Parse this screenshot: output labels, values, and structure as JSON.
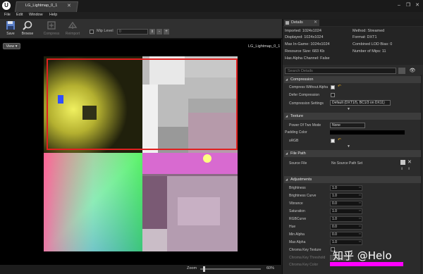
{
  "window": {
    "tab_title": "LG_Lightmap_0_1",
    "logo": "U",
    "close": "✕",
    "controls": [
      "–",
      "❐",
      "✕"
    ]
  },
  "menu": [
    "File",
    "Edit",
    "Window",
    "Help"
  ],
  "toolbar": {
    "save_label": "Save",
    "browse_label": "Browse",
    "compress_label": "Compress",
    "reimport_label": "Reimport",
    "mip_level_label": "Mip Level",
    "mip_level_value": "0",
    "spin_icon": "⇕",
    "minus_label": "-",
    "plus_label": "+"
  },
  "viewport": {
    "view_button": "View ▾",
    "texture_label": "LG_Lightmap_0_1",
    "zoom_label": "Zoom",
    "zoom_value": "60%",
    "zoom_level": 0.05
  },
  "details": {
    "tab_label": "Details",
    "close": "✕",
    "eye_icon": "👁",
    "info_left": [
      "Imported: 1024x1024",
      "Displayed: 1024x1024",
      "Max In-Game: 1024x1024",
      "Resource Size: 683 Kb",
      "Has Alpha Channel: False"
    ],
    "info_right": [
      "Method: Streamed",
      "Format: DXT1",
      "Combined LOD Bias: 0",
      "Number of Mips: 11"
    ],
    "search_placeholder": "Search Details",
    "compression": {
      "title": "Compression",
      "compress_without_alpha": "Compress Without Alpha",
      "defer_compression": "Defer Compression",
      "compression_settings": "Compression Settings",
      "compression_settings_value": "Default (DXT1/5, BC1/3 on DX11)"
    },
    "texture": {
      "title": "Texture",
      "power_of_two": "Power Of Two Mode",
      "power_of_two_value": "None",
      "padding_color": "Padding Color",
      "srgb": "sRGB"
    },
    "file_path": {
      "title": "File Path",
      "source_file": "Source File",
      "source_file_value": "No Source Path Set"
    },
    "adjustments": {
      "title": "Adjustments",
      "rows": [
        {
          "label": "Brightness",
          "value": "1.0"
        },
        {
          "label": "Brightness Curve",
          "value": "1.0"
        },
        {
          "label": "Vibrance",
          "value": "0.0"
        },
        {
          "label": "Saturation",
          "value": "1.0"
        },
        {
          "label": "RGBCurve",
          "value": "1.0"
        },
        {
          "label": "Hue",
          "value": "0.0"
        },
        {
          "label": "Min Alpha",
          "value": "0.0"
        },
        {
          "label": "Max Alpha",
          "value": "1.0"
        }
      ],
      "chroma_key_texture": "Chroma Key Texture",
      "chroma_key_threshold": "Chroma Key Threshold",
      "chroma_key_color": "Chroma Key Color"
    }
  },
  "watermark": "知乎 @Helo",
  "colors": {
    "highlight_rect": "#e02020",
    "chroma_key_color": "#ff00ff",
    "reset_arrow": "#d8a020"
  }
}
